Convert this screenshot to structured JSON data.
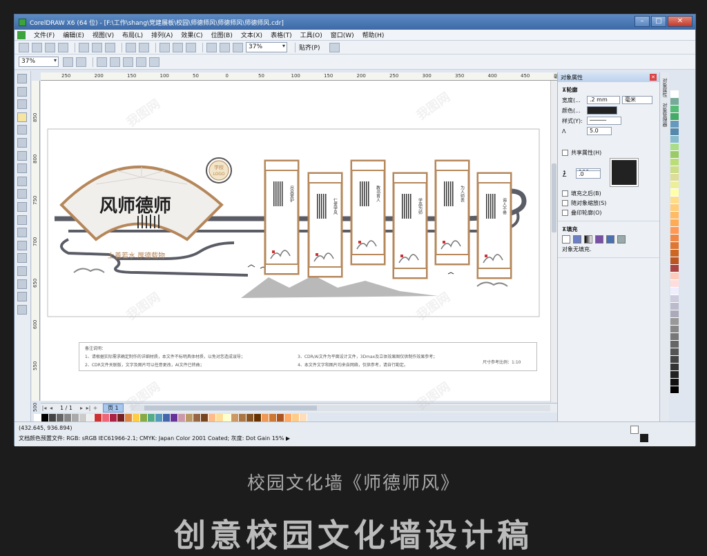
{
  "window": {
    "title": "CorelDRAW X6 (64 位) - [F:\\工作\\shang\\党建展板\\校园\\师德师风\\师德师风\\师德师风.cdr]"
  },
  "menu": [
    "文件(F)",
    "编辑(E)",
    "视图(V)",
    "布局(L)",
    "排列(A)",
    "效果(C)",
    "位图(B)",
    "文本(X)",
    "表格(T)",
    "工具(O)",
    "窗口(W)",
    "帮助(H)"
  ],
  "toolbar": {
    "zoom_value": "37%",
    "snap_label": "贴齐(P)",
    "zoom2_value": "37%"
  },
  "ruler_h": [
    "250",
    "200",
    "150",
    "100",
    "50",
    "0",
    "50",
    "100",
    "150",
    "200",
    "250",
    "300",
    "350",
    "400",
    "450",
    "毫米"
  ],
  "ruler_v": [
    "850",
    "800",
    "750",
    "700",
    "650",
    "600",
    "550",
    "500"
  ],
  "design": {
    "fan_title": "风师德师",
    "subtitle": "上善若水  厚德载物",
    "logo_line1": "学校",
    "logo_line2": "LOGO",
    "panels": [
      "尽其爱护",
      "仁爱学风",
      "教书育人",
      "学高为师",
      "为人师表",
      "诲人不倦"
    ]
  },
  "notes": {
    "title": "备注说明：",
    "line1": "1、请根据实际需求确定制作的详细材质，本文件不标明具体材质，以免对您造成误导；",
    "line2": "2、CDR文件关联版，文字及图片可以任意更改，AI文件已转曲；",
    "line3": "3、CDR/AI文件为平面设计文件，3Dmax及立体效果图仅供制作效果参考；",
    "line4": "4、本文件文字和图片均来自网络，仅供参考，请自行勘定。",
    "scale": "尺寸参考比例：1:10"
  },
  "pagenav": {
    "page_label": "1 / 1",
    "tab_label": "页 1"
  },
  "status": {
    "coords": "(432.645, 936.894)",
    "profile": "文档颜色预置文件: RGB: sRGB IEC61966-2.1; CMYK: Japan Color 2001 Coated; 灰度: Dot Gain 15% ▶"
  },
  "docker": {
    "title": "对象属性",
    "outline_title": "轮廓",
    "width_label": "宽度(...",
    "width_value": ".2 mm",
    "unit": "毫米",
    "color_label": "颜色(...",
    "style_label": "样式(Y):",
    "miter_value": "5.0",
    "shared_label": "共享属性(H)",
    "scale_value": "100",
    "angle_value": ".0",
    "behind_label": "填充之后(B)",
    "scale_with_label": "随对象缩放(S)",
    "overprint_label": "叠印轮廓(O)",
    "fill_title": "填充",
    "nofill_label": "对象无填充."
  },
  "tabs": [
    "对象属性",
    "对象管理器"
  ],
  "caption": {
    "line1": "校园文化墙《师德师风》",
    "line2": "创意校园文化墙设计稿"
  },
  "watermark": "我图网",
  "colors": {
    "brown": "#b5875a",
    "dark": "#2b2b2b",
    "grey": "#5a5c66",
    "accent": "#3d6aa6"
  }
}
